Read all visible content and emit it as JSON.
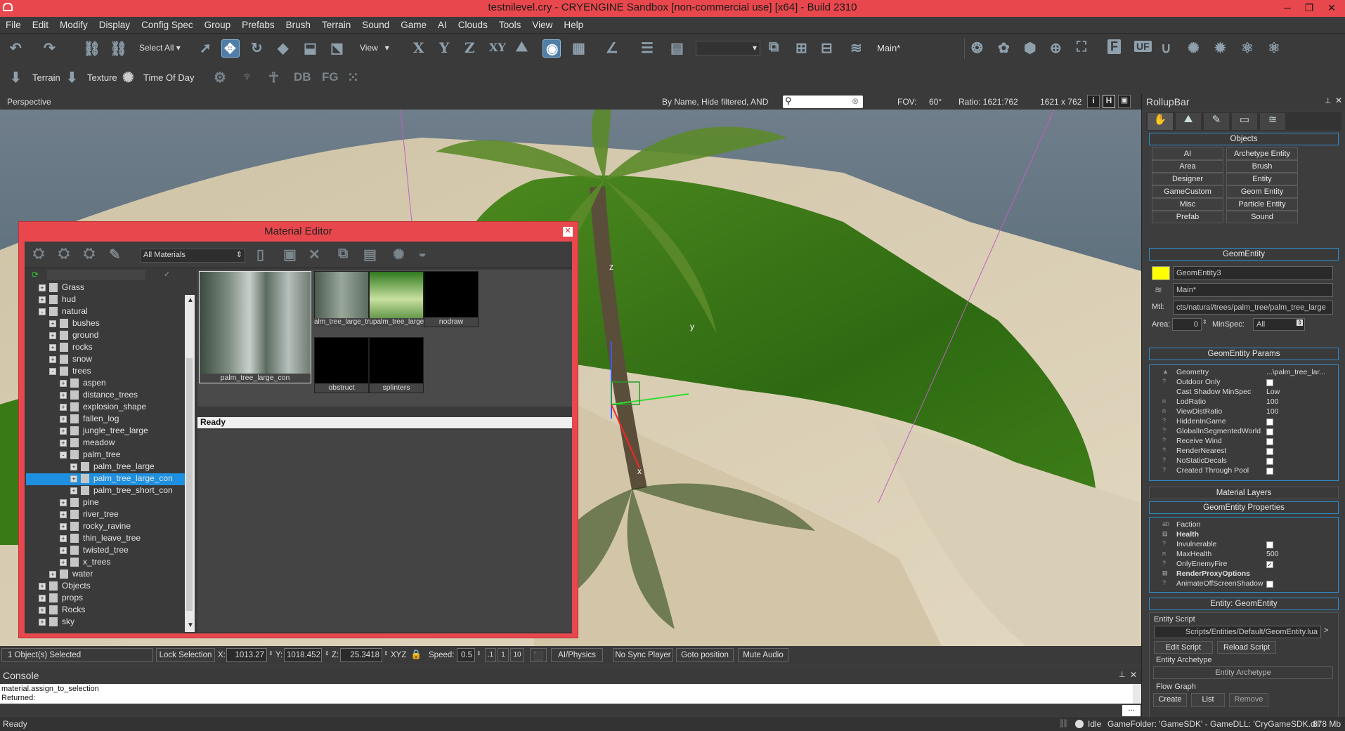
{
  "window": {
    "title": "testnilevel.cry - CRYENGINE Sandbox [non-commercial use] [x64] - Build 2310"
  },
  "menu": [
    "File",
    "Edit",
    "Modify",
    "Display",
    "Config Spec",
    "Group",
    "Prefabs",
    "Brush",
    "Terrain",
    "Sound",
    "Game",
    "AI",
    "Clouds",
    "Tools",
    "View",
    "Help"
  ],
  "toolbar1": {
    "select_all": "Select All",
    "view": "View",
    "axis_x": "X",
    "axis_y": "Y",
    "axis_z": "Z",
    "axis_xy": "XY",
    "layer": "Main*"
  },
  "toolbar2": {
    "terrain": "Terrain",
    "texture": "Texture",
    "time_of_day": "Time Of Day",
    "db": "DB",
    "fg": "FG",
    "right_letters": [
      "F",
      "UF"
    ]
  },
  "viewbar": {
    "perspective": "Perspective",
    "filter": "By Name, Hide filtered, AND",
    "fov_label": "FOV:",
    "fov": "60°",
    "ratio_label": "Ratio: 1621:762",
    "resolution": "1621 x 762",
    "btn_i": "i",
    "btn_h": "H"
  },
  "viewport": {
    "axis_x": "x",
    "axis_y": "y",
    "axis_z": "z"
  },
  "material_editor": {
    "title": "Material Editor",
    "filter": "All Materials",
    "tree": [
      {
        "label": "Grass",
        "indent": 0,
        "sign": "+"
      },
      {
        "label": "hud",
        "indent": 0,
        "sign": "+"
      },
      {
        "label": "natural",
        "indent": 0,
        "sign": "-"
      },
      {
        "label": "bushes",
        "indent": 1,
        "sign": "+"
      },
      {
        "label": "ground",
        "indent": 1,
        "sign": "+"
      },
      {
        "label": "rocks",
        "indent": 1,
        "sign": "+"
      },
      {
        "label": "snow",
        "indent": 1,
        "sign": "+"
      },
      {
        "label": "trees",
        "indent": 1,
        "sign": "-"
      },
      {
        "label": "aspen",
        "indent": 2,
        "sign": "+"
      },
      {
        "label": "distance_trees",
        "indent": 2,
        "sign": "+"
      },
      {
        "label": "explosion_shape",
        "indent": 2,
        "sign": "+"
      },
      {
        "label": "fallen_log",
        "indent": 2,
        "sign": "+"
      },
      {
        "label": "jungle_tree_large",
        "indent": 2,
        "sign": "+"
      },
      {
        "label": "meadow",
        "indent": 2,
        "sign": "+"
      },
      {
        "label": "palm_tree",
        "indent": 2,
        "sign": "-"
      },
      {
        "label": "palm_tree_large",
        "indent": 3,
        "sign": "+"
      },
      {
        "label": "palm_tree_large_con",
        "indent": 3,
        "sign": "+"
      },
      {
        "label": "palm_tree_short_con",
        "indent": 3,
        "sign": "+"
      },
      {
        "label": "pine",
        "indent": 2,
        "sign": "+"
      },
      {
        "label": "river_tree",
        "indent": 2,
        "sign": "+"
      },
      {
        "label": "rocky_ravine",
        "indent": 2,
        "sign": "+"
      },
      {
        "label": "thin_leave_tree",
        "indent": 2,
        "sign": "+"
      },
      {
        "label": "twisted_tree",
        "indent": 2,
        "sign": "+"
      },
      {
        "label": "x_trees",
        "indent": 2,
        "sign": "+"
      },
      {
        "label": "water",
        "indent": 1,
        "sign": "+"
      },
      {
        "label": "Objects",
        "indent": 0,
        "sign": "+"
      },
      {
        "label": "props",
        "indent": 0,
        "sign": "+"
      },
      {
        "label": "Rocks",
        "indent": 0,
        "sign": "+"
      },
      {
        "label": "sky",
        "indent": 0,
        "sign": "+"
      }
    ],
    "selected": "palm_tree_large_con",
    "thumbs": [
      "palm_tree_large_con",
      "alm_tree_large_trupalm_tree_large_lea",
      "nodraw",
      "obstruct",
      "splinters"
    ],
    "status": "Ready"
  },
  "rollup": {
    "title": "RollupBar",
    "objects_title": "Objects",
    "objects": [
      "AI",
      "Archetype Entity",
      "Area",
      "Brush",
      "Designer",
      "Entity",
      "GameCustom",
      "Geom Entity",
      "Misc",
      "Particle Entity",
      "Prefab",
      "Sound"
    ],
    "geomentity_title": "GeomEntity",
    "name": "GeomEntity3",
    "layer": "Main*",
    "mtl_label": "Mtl:",
    "mtl": "cts/natural/trees/palm_tree/palm_tree_large",
    "area_label": "Area:",
    "area": "0",
    "minspec_label": "MinSpec:",
    "minspec": "All",
    "params_title": "GeomEntity Params",
    "params": [
      {
        "icon": "▲",
        "name": "Geometry",
        "value": "...\\palm_tree_lar..."
      },
      {
        "icon": "?",
        "name": "Outdoor Only",
        "check": false
      },
      {
        "icon": "",
        "name": "Cast Shadow MinSpec",
        "value": "Low"
      },
      {
        "icon": "n",
        "name": "LodRatio",
        "value": "100"
      },
      {
        "icon": "n",
        "name": "ViewDistRatio",
        "value": "100"
      },
      {
        "icon": "?",
        "name": "HiddenInGame",
        "check": false
      },
      {
        "icon": "?",
        "name": "GlobalInSegmentedWorld",
        "check": false
      },
      {
        "icon": "?",
        "name": "Receive Wind",
        "check": false
      },
      {
        "icon": "?",
        "name": "RenderNearest",
        "check": false
      },
      {
        "icon": "?",
        "name": "NoStaticDecals",
        "check": false
      },
      {
        "icon": "?",
        "name": "Created Through Pool",
        "check": false
      }
    ],
    "material_layers": "Material Layers",
    "props_title": "GeomEntity Properties",
    "props": [
      {
        "icon": "ab",
        "name": "Faction",
        "value": ""
      },
      {
        "icon": "⊟",
        "name": "Health",
        "group": true
      },
      {
        "icon": "?",
        "name": "Invulnerable",
        "check": false
      },
      {
        "icon": "n",
        "name": "MaxHealth",
        "value": "500"
      },
      {
        "icon": "?",
        "name": "OnlyEnemyFire",
        "check": true
      },
      {
        "icon": "⊟",
        "name": "RenderProxyOptions",
        "group": true
      },
      {
        "icon": "?",
        "name": "AnimateOffScreenShadow",
        "check": false
      }
    ],
    "entity_title": "Entity: GeomEntity",
    "entity_script_label": "Entity Script",
    "entity_script": "Scripts/Entities/Default/GeomEntity.lua",
    "edit_script": "Edit Script",
    "reload_script": "Reload Script",
    "archetype_label": "Entity Archetype",
    "archetype_btn": "Entity Archetype",
    "flowgraph_label": "Flow Graph",
    "fg_create": "Create",
    "fg_list": "List",
    "fg_remove": "Remove"
  },
  "status": {
    "selected": "1 Object(s) Selected",
    "lock": "Lock Selection",
    "x_label": "X:",
    "x": "1013.27",
    "y_label": "Y:",
    "y": "1018.452",
    "z_label": "Z:",
    "z": "25.3418",
    "xyz": "XYZ",
    "speed_label": "Speed:",
    "speed": "0.5",
    "speed_opts": [
      ".1",
      "1",
      "10"
    ],
    "ai_physics": "AI/Physics",
    "no_sync": "No Sync Player",
    "goto": "Goto position",
    "mute": "Mute Audio"
  },
  "console": {
    "title": "Console",
    "lines": [
      "material.assign_to_selection",
      "Returned:"
    ],
    "more": "..."
  },
  "statusbar": {
    "ready": "Ready",
    "idle": "Idle",
    "gamefolder": "GameFolder: 'GameSDK' - GameDLL: 'CryGameSDK.dll'",
    "mem": "878 Mb"
  }
}
